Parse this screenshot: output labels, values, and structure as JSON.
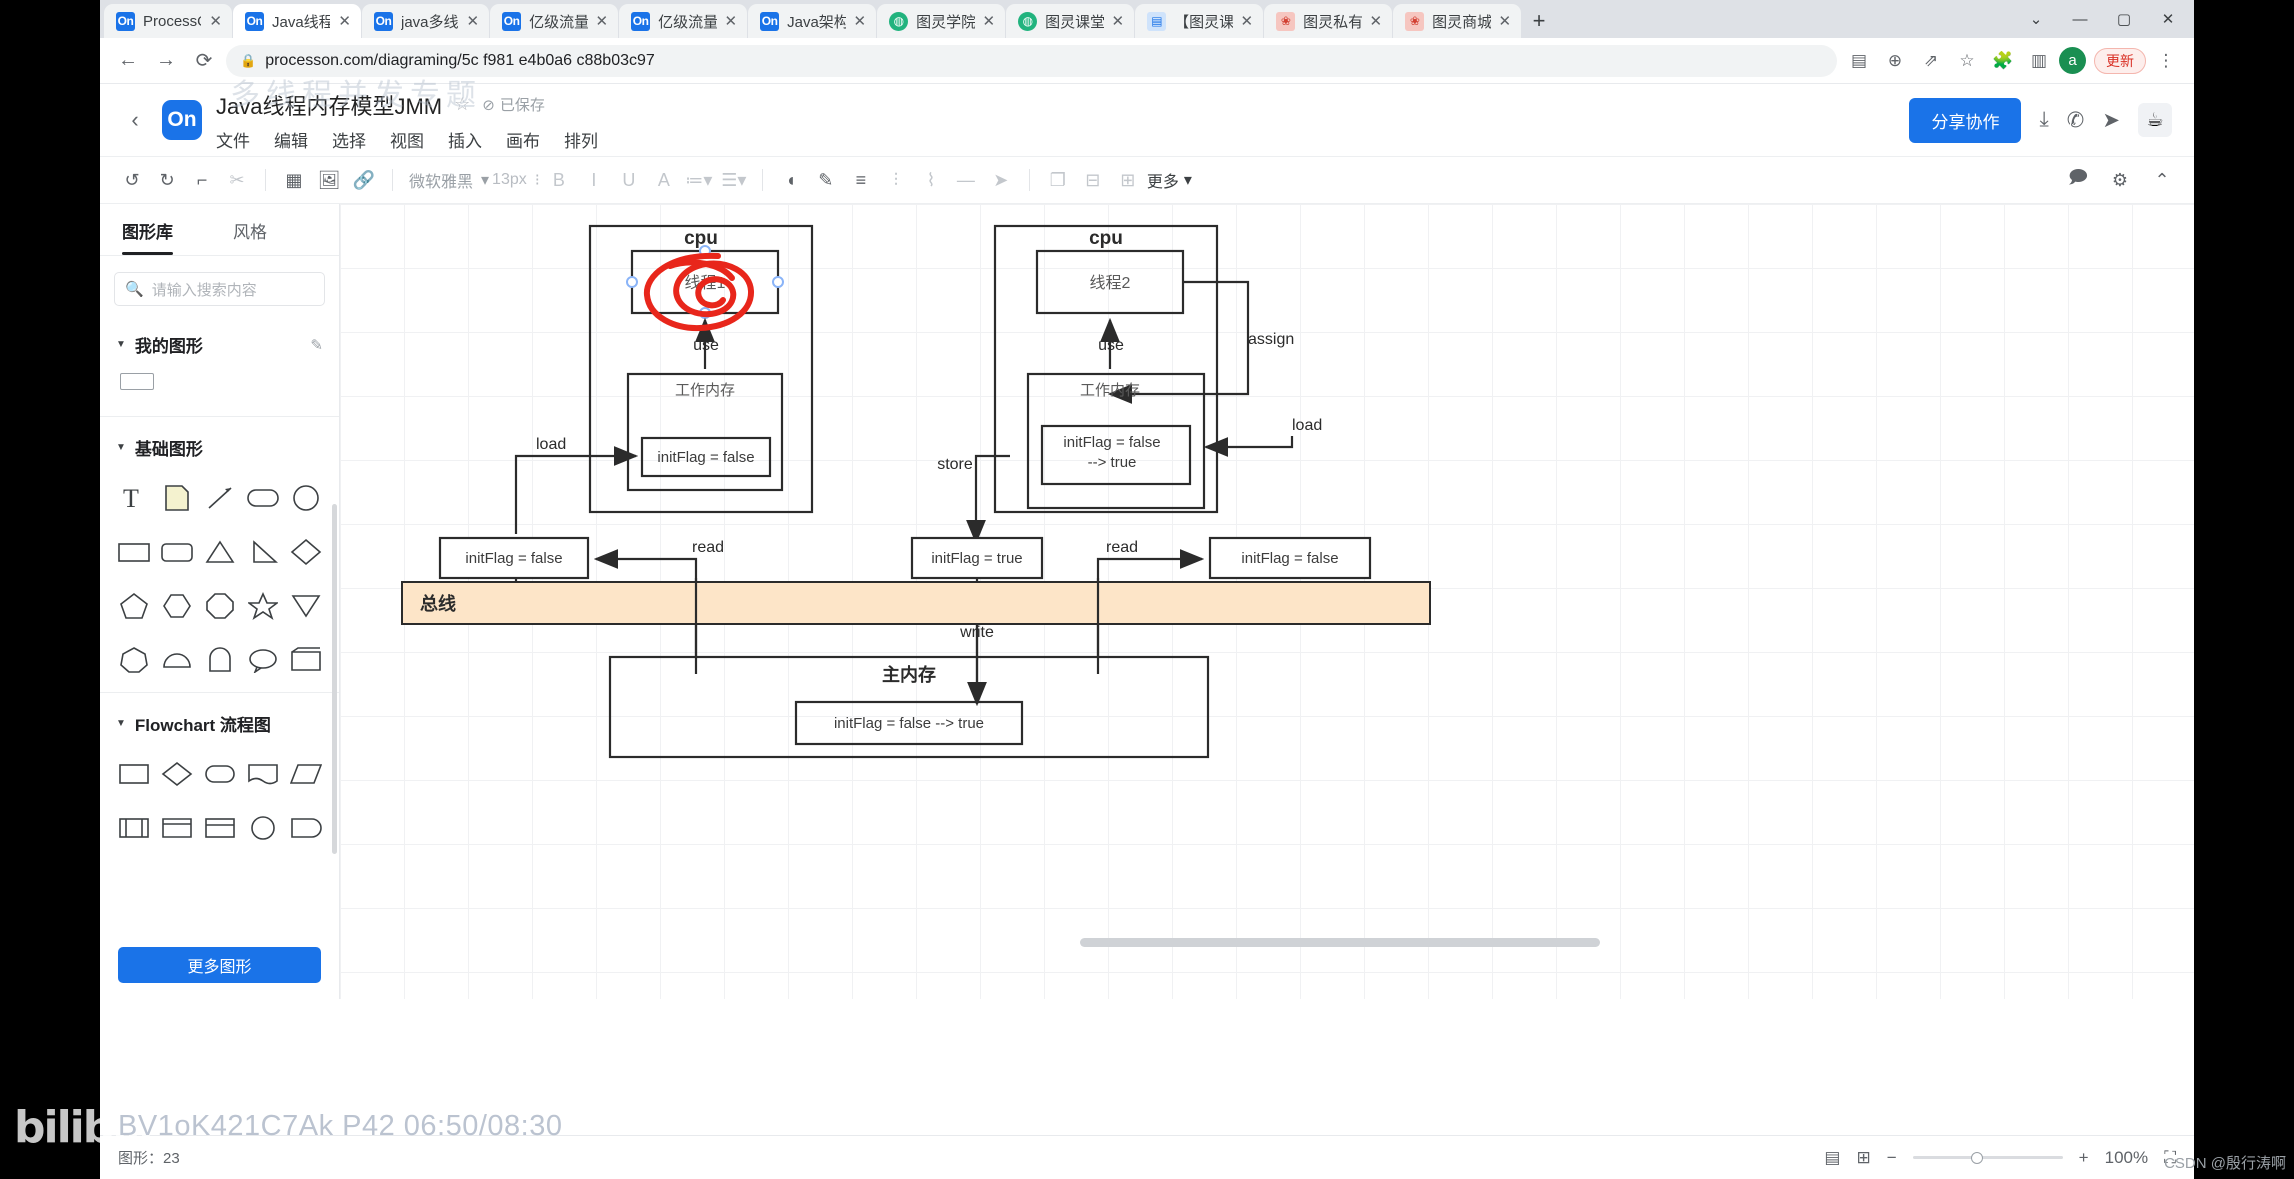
{
  "browser": {
    "tabs": [
      {
        "label": "ProcessO",
        "favicon": "on-icon",
        "active": false
      },
      {
        "label": "Java线程",
        "favicon": "on-icon",
        "active": true
      },
      {
        "label": "java多线",
        "favicon": "on-icon",
        "active": false
      },
      {
        "label": "亿级流量",
        "favicon": "on-icon",
        "active": false
      },
      {
        "label": "亿级流量",
        "favicon": "on-icon",
        "active": false
      },
      {
        "label": "Java架构",
        "favicon": "on-icon",
        "active": false
      },
      {
        "label": "图灵学院",
        "favicon": "globe-icon",
        "active": false
      },
      {
        "label": "图灵课堂",
        "favicon": "globe-icon",
        "active": false
      },
      {
        "label": "【图灵课",
        "favicon": "book-icon",
        "active": false
      },
      {
        "label": "图灵私有",
        "favicon": "flower-icon",
        "active": false
      },
      {
        "label": "图灵商城",
        "favicon": "flower-icon",
        "active": false
      }
    ],
    "new_tab": "+",
    "close_glyph": "✕",
    "window_controls": {
      "minimize": "—",
      "maximize": "▢",
      "close": "✕",
      "chevron": "⌄"
    },
    "nav": {
      "back": "←",
      "forward": "→",
      "reload": "⟳"
    },
    "url": "processon.com/diagraming/5c  f981  e4b0a6 c88b03c97",
    "lock_icon": "lock-icon",
    "omni_actions": [
      "clipboard-icon",
      "zoom-icon",
      "share-icon",
      "bookmark-star-icon",
      "extensions-icon",
      "sidepanel-icon"
    ],
    "avatar_letter": "a",
    "update_label": "更新",
    "menu_glyph": "⋮"
  },
  "app": {
    "back_chevron": "‹",
    "logo_text": "On",
    "doc_title": "Java线程内存模型JMM",
    "star_icon": "star-icon",
    "saved_label": "已保存",
    "saved_icon": "check-circle-icon",
    "menus": [
      "文件",
      "编辑",
      "选择",
      "视图",
      "插入",
      "画布",
      "排列"
    ],
    "share_label": "分享协作",
    "header_icons": [
      "download-icon",
      "phone-icon",
      "send-icon",
      "java-cup-icon"
    ]
  },
  "toolbar": {
    "undo_icon": "undo-icon",
    "redo_icon": "redo-icon",
    "format_painter_icon": "format-painter-icon",
    "eraser_icon": "eraser-icon",
    "table_icon": "table-icon",
    "image_icon": "image-icon",
    "link_icon": "link-icon",
    "font_name": "微软雅黑",
    "font_size": "13px",
    "bold": "B",
    "italic": "I",
    "underline": "U",
    "text_color": "A",
    "list_ordered_icon": "list-ordered-icon",
    "list_unordered_icon": "list-unordered-icon",
    "fill_icon": "fill-icon",
    "line_color_icon": "line-color-icon",
    "align_icon": "align-icon",
    "valign_icon": "valign-icon",
    "connector_icon": "connector-icon",
    "line_style_icon": "line-style-icon",
    "arrow_icon": "arrow-icon",
    "layer_icon": "layer-icon",
    "distribute_icon": "distribute-icon",
    "grid_icon": "grid-icon",
    "more_label": "更多",
    "comment_icon": "comment-icon",
    "settings_icon": "settings-icon",
    "collapse_icon": "chevron-up-icon"
  },
  "panel": {
    "tabs": [
      {
        "label": "图形库",
        "active": true
      },
      {
        "label": "风格",
        "active": false
      }
    ],
    "search_placeholder": "请输入搜索内容",
    "search_icon": "search-icon",
    "sections": [
      {
        "title": "我的图形",
        "edit_icon": "pencil-icon"
      },
      {
        "title": "基础图形"
      },
      {
        "title": "Flowchart 流程图"
      }
    ],
    "more_shapes_label": "更多图形"
  },
  "status": {
    "shapes_label": "图形：23",
    "page_icon": "page-icon",
    "layout_icon": "layout-icon",
    "zoom_out": "−",
    "zoom_in": "+",
    "zoom_level": "100%",
    "fullscreen_icon": "fullscreen-icon"
  },
  "overlay": {
    "bili_logo": "bilibili",
    "video_id": "BV1oK421C7Ak  P42  06:50/08:30",
    "watermark": "CSDN @殷行涛啊",
    "ghost_title": "多线程并发专题"
  },
  "diagram": {
    "cpu_left": {
      "title": "cpu",
      "thread": "线程1",
      "use_label": "use",
      "working_memory": "工作内存",
      "var_box": "initFlag = false"
    },
    "cpu_right": {
      "title": "cpu",
      "thread": "线程2",
      "use_label": "use",
      "assign_label": "assign",
      "working_memory": "工作内存",
      "var_box_line1": "initFlag = false",
      "var_box_line2": "--> true"
    },
    "cache_boxes": [
      {
        "label": "initFlag = false"
      },
      {
        "label": "initFlag = true"
      },
      {
        "label": "initFlag = false"
      }
    ],
    "edge_labels": {
      "load_left": "load",
      "read_left": "read",
      "store": "store",
      "write": "write",
      "read_right": "read",
      "load_right": "load"
    },
    "bus_label": "总线",
    "bus_color": "#fde5c8",
    "main_memory": {
      "title": "主内存",
      "var_box": "initFlag = false --> true"
    },
    "annotation_color": "#e8261b"
  }
}
